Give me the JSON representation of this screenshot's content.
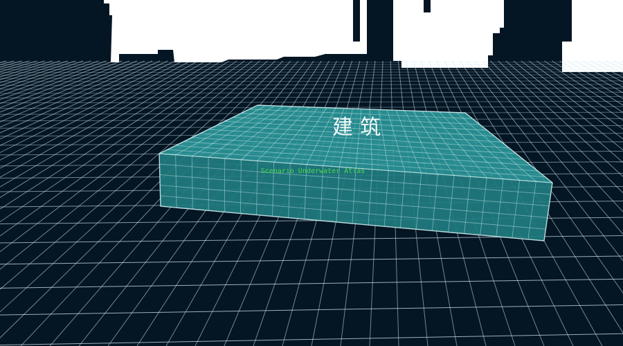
{
  "scene": {
    "building_title": "建筑",
    "building_subtitle": "Scenario Underwater Atlas",
    "colors": {
      "background": "#041523",
      "grid_line": "#cfe6ee",
      "block_fill": "#2b9a9c",
      "block_edge": "#d8f4f4",
      "sky_cutout": "#ffffff",
      "subtitle": "#4dd64d",
      "title": "#ffffff"
    }
  }
}
